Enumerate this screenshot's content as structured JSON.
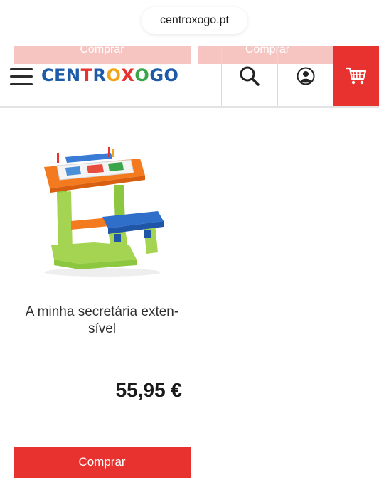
{
  "browser": {
    "url": "centroxogo.pt"
  },
  "previous_row": {
    "buy_left_label": "Comprar",
    "buy_right_label": "Comprar"
  },
  "header": {
    "logo_letters": [
      {
        "ch": "C",
        "color": "#1e5aa8"
      },
      {
        "ch": "E",
        "color": "#1e5aa8"
      },
      {
        "ch": "N",
        "color": "#1e5aa8"
      },
      {
        "ch": "T",
        "color": "#e8322f"
      },
      {
        "ch": "R",
        "color": "#1e5aa8"
      },
      {
        "ch": "O",
        "color": "#f2a51a"
      },
      {
        "ch": "X",
        "color": "#e8322f"
      },
      {
        "ch": "O",
        "color": "#3aa54a"
      },
      {
        "ch": "G",
        "color": "#1e5aa8"
      },
      {
        "ch": "O",
        "color": "#1e5aa8"
      }
    ],
    "menu_icon": "hamburger-icon",
    "search_icon": "search-icon",
    "account_icon": "user-icon",
    "cart_icon": "cart-icon",
    "cart_bg": "#e8322f"
  },
  "product": {
    "name": "A minha secretária exten-\nsível",
    "price": "55,95 €",
    "buy_label": "Comprar",
    "image": "kids-desk-toy"
  }
}
